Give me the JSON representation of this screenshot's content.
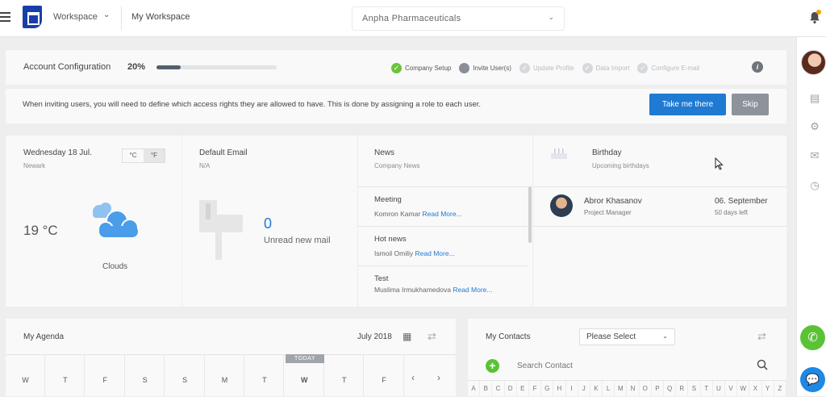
{
  "topbar": {
    "workspace_label": "Workspace",
    "my_workspace": "My Workspace",
    "company": "Anpha Pharmaceuticals"
  },
  "account": {
    "title": "Account Configuration",
    "percent_label": "20%",
    "progress": 0.2,
    "steps": [
      {
        "label": "Company Setup",
        "state": "done"
      },
      {
        "label": "Invite User(s)",
        "state": "current"
      },
      {
        "label": "Update Profile",
        "state": "todo"
      },
      {
        "label": "Data Import",
        "state": "todo"
      },
      {
        "label": "Configure E-mail",
        "state": "todo"
      }
    ]
  },
  "invite": {
    "text": "When inviting users, you will need to define which access rights they are allowed to have. This is done by assigning a role to each user.",
    "primary_label": "Take me there",
    "skip_label": "Skip"
  },
  "weather": {
    "date": "Wednesday 18 Jul.",
    "location": "Newark",
    "unit_c": "°C",
    "unit_f": "°F",
    "temperature": "19 °C",
    "condition": "Clouds"
  },
  "email": {
    "title": "Default Email",
    "sub": "N/A",
    "count": "0",
    "label": "Unread new mail"
  },
  "news": {
    "title": "News",
    "sub": "Company News",
    "items": [
      {
        "title": "Meeting",
        "author": "Komron Kamar",
        "more": "Read More..."
      },
      {
        "title": "Hot news",
        "author": "Ismoil Omiliy",
        "more": "Read More..."
      },
      {
        "title": "Test",
        "author": "Muslima Irmukhamedova",
        "more": "Read More..."
      }
    ]
  },
  "birthday": {
    "title": "Birthday",
    "sub": "Upcoming birthdays",
    "person": {
      "name": "Abror Khasanov",
      "role": "Project Manager",
      "date": "06. September",
      "days_left": "50 days left"
    }
  },
  "agenda": {
    "title": "My Agenda",
    "month": "July 2018",
    "today_label": "TODAY",
    "days": [
      "W",
      "T",
      "F",
      "S",
      "S",
      "M",
      "T",
      "W",
      "T",
      "F"
    ],
    "today_index": 7
  },
  "contacts": {
    "title": "My Contacts",
    "select_value": "Please Select",
    "search_placeholder": "Search Contact",
    "letters": [
      "A",
      "B",
      "C",
      "D",
      "E",
      "F",
      "G",
      "H",
      "I",
      "J",
      "K",
      "L",
      "M",
      "N",
      "O",
      "P",
      "Q",
      "R",
      "S",
      "T",
      "U",
      "V",
      "W",
      "X",
      "Y",
      "Z"
    ]
  },
  "colors": {
    "primary": "#1f7ad3",
    "success": "#5bc236",
    "brand": "#1a3ea8",
    "notification": "#f0a400"
  }
}
